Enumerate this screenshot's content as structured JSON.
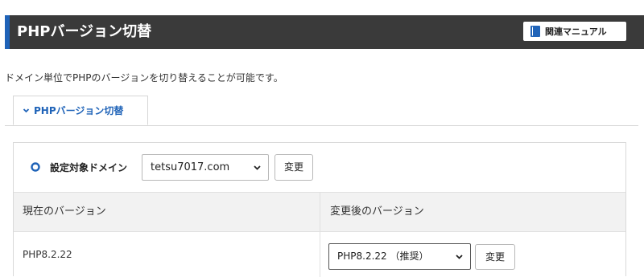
{
  "header": {
    "title": "PHPバージョン切替",
    "manual_button": "関連マニュアル",
    "manual_icon": "book-icon"
  },
  "description": "ドメイン単位でPHPのバージョンを切り替えることが可能です。",
  "tab": {
    "label": "PHPバージョン切替",
    "icon": "chevron-down-icon"
  },
  "domain_setting": {
    "label": "設定対象ドメイン",
    "selected_domain": "tetsu7017.com",
    "change_button": "変更"
  },
  "version_table": {
    "headers": [
      "現在のバージョン",
      "変更後のバージョン"
    ],
    "current_version": "PHP8.2.22",
    "selected_new_version": "PHP8.2.22 （推奨）",
    "change_button": "変更"
  },
  "colors": {
    "header_bg": "#3a3a3a",
    "accent": "#1f63b8",
    "tab_text": "#1f63b8",
    "table_header_bg": "#f2f2f2"
  }
}
